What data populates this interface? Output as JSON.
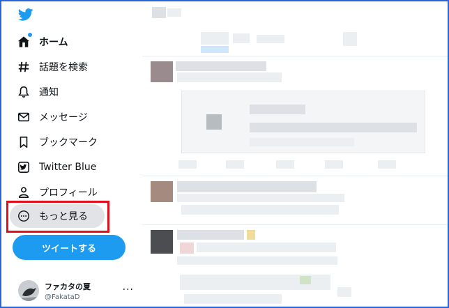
{
  "sidebar": {
    "items": [
      {
        "label": "ホーム",
        "icon": "home-icon",
        "active": true
      },
      {
        "label": "話題を検索",
        "icon": "hashtag-icon"
      },
      {
        "label": "通知",
        "icon": "bell-icon"
      },
      {
        "label": "メッセージ",
        "icon": "envelope-icon"
      },
      {
        "label": "ブックマーク",
        "icon": "bookmark-icon"
      },
      {
        "label": "Twitter Blue",
        "icon": "twitter-blue-icon"
      },
      {
        "label": "プロフィール",
        "icon": "person-icon"
      },
      {
        "label": "もっと見る",
        "icon": "more-circle-icon"
      }
    ],
    "tweet_button": "ツイートする",
    "account": {
      "name": "ファカタの夏",
      "handle": "@FakataD",
      "more": "···"
    }
  },
  "colors": {
    "brand": "#1d9bf0",
    "highlight": "#e0101a",
    "frame": "#2b63d8"
  }
}
